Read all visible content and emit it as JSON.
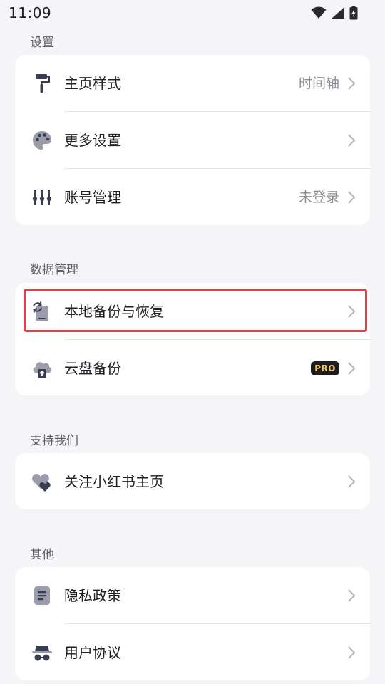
{
  "status_bar": {
    "time": "11:09",
    "icons": [
      "wifi-icon",
      "cellular-signal-icon",
      "battery-charging-icon"
    ]
  },
  "sections": {
    "settings": {
      "title": "设置",
      "rows": [
        {
          "label": "主页样式",
          "value": "时间轴",
          "icon": "paint-roller-icon"
        },
        {
          "label": "更多设置",
          "value": "",
          "icon": "palette-icon"
        },
        {
          "label": "账号管理",
          "value": "未登录",
          "icon": "sliders-icon"
        }
      ]
    },
    "data": {
      "title": "数据管理",
      "rows": [
        {
          "label": "本地备份与恢复",
          "icon": "phone-sync-icon"
        },
        {
          "label": "云盘备份",
          "badge": "PRO",
          "icon": "cloud-upload-icon"
        }
      ]
    },
    "support": {
      "title": "支持我们",
      "rows": [
        {
          "label": "关注小红书主页",
          "icon": "hearts-icon"
        }
      ]
    },
    "other": {
      "title": "其他",
      "rows": [
        {
          "label": "隐私政策",
          "icon": "document-icon"
        },
        {
          "label": "用户协议",
          "icon": "incognito-icon"
        }
      ]
    }
  },
  "colors": {
    "background": "#f5f5f7",
    "card": "#ffffff",
    "icon": "#3a3d52",
    "icon_light": "#9a9cab",
    "highlight": "#d9434a",
    "pro_text": "#f5c46a"
  }
}
